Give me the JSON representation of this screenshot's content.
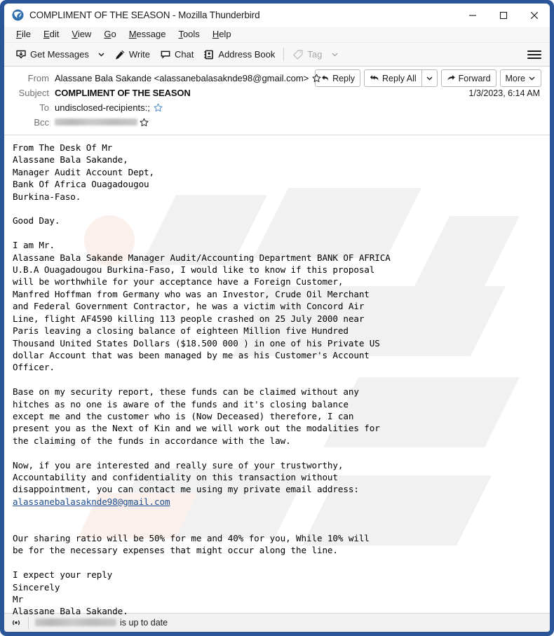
{
  "window": {
    "title": "COMPLIMENT OF THE SEASON - Mozilla Thunderbird",
    "logo_icon": "thunderbird-logo-icon",
    "controls": {
      "minimize": "minimize-icon",
      "maximize": "maximize-icon",
      "close": "close-icon"
    },
    "accent_color": "#2a5699"
  },
  "menubar": {
    "items": [
      {
        "label": "File",
        "accesskey": "F"
      },
      {
        "label": "Edit",
        "accesskey": "E"
      },
      {
        "label": "View",
        "accesskey": "V"
      },
      {
        "label": "Go",
        "accesskey": "G"
      },
      {
        "label": "Message",
        "accesskey": "M"
      },
      {
        "label": "Tools",
        "accesskey": "T"
      },
      {
        "label": "Help",
        "accesskey": "H"
      }
    ]
  },
  "toolbar": {
    "get_messages_label": "Get Messages",
    "get_messages_icon": "download-inbox-icon",
    "get_messages_caret_icon": "chevron-down-icon",
    "write_label": "Write",
    "write_icon": "pencil-icon",
    "chat_label": "Chat",
    "chat_icon": "chat-bubble-icon",
    "address_book_label": "Address Book",
    "address_book_icon": "address-book-icon",
    "tag_label": "Tag",
    "tag_icon": "tag-icon",
    "tag_caret_icon": "chevron-down-icon",
    "tag_disabled": true,
    "app_menu_icon": "hamburger-menu-icon"
  },
  "message_header": {
    "from_label": "From",
    "from_value": "Alassane Bala Sakande <alassanebalasaknde98@gmail.com>",
    "subject_label": "Subject",
    "subject_value": "COMPLIMENT OF THE SEASON",
    "date": "1/3/2023, 6:14 AM",
    "to_label": "To",
    "to_value": "undisclosed-recipients:;",
    "bcc_label": "Bcc",
    "bcc_value": "",
    "bcc_redacted": true,
    "star_icon": "star-icon",
    "actions": {
      "reply_label": "Reply",
      "reply_icon": "reply-arrow-icon",
      "reply_all_label": "Reply All",
      "reply_all_icon": "reply-all-arrow-icon",
      "reply_all_caret_icon": "chevron-down-icon",
      "forward_label": "Forward",
      "forward_icon": "forward-arrow-icon",
      "more_label": "More",
      "more_caret_icon": "chevron-down-icon"
    }
  },
  "message_body": {
    "text_before_link": "From The Desk Of Mr\nAlassane Bala Sakande,\nManager Audit Account Dept,\nBank Of Africa Ouagadougou\nBurkina-Faso.\n\nGood Day.\n\nI am Mr.\nAlassane Bala Sakande Manager Audit/Accounting Department BANK OF AFRICA\nU.B.A Ouagadougou Burkina-Faso, I would like to know if this proposal\nwill be worthwhile for your acceptance have a Foreign Customer,\nManfred Hoffman from Germany who was an Investor, Crude Oil Merchant\nand Federal Government Contractor, he was a victim with Concord Air\nLine, flight AF4590 killing 113 people crashed on 25 July 2000 near\nParis leaving a closing balance of eighteen Million five Hundred\nThousand United States Dollars ($18.500 000 ) in one of his Private US\ndollar Account that was been managed by me as his Customer's Account\nOfficer.\n\nBase on my security report, these funds can be claimed without any\nhitches as no one is aware of the funds and it's closing balance\nexcept me and the customer who is (Now Deceased) therefore, I can\npresent you as the Next of Kin and we will work out the modalities for\nthe claiming of the funds in accordance with the law.\n\nNow, if you are interested and really sure of your trustworthy,\nAccountability and confidentiality on this transaction without\ndisappointment, you can contact me using my private email address:\n",
    "link_text": "alassanebalasaknde98@gmail.com",
    "link_color": "#1a4b8c",
    "text_after_link": "\n\n\nOur sharing ratio will be 50% for me and 40% for you, While 10% will\nbe for the necessary expenses that might occur along the line.\n\nI expect your reply\nSincerely\nMr\nAlassane Bala Sakande."
  },
  "statusbar": {
    "connection_icon": "broadcast-icon",
    "account_redacted": true,
    "account_value": "",
    "status_text": "is up to date"
  }
}
